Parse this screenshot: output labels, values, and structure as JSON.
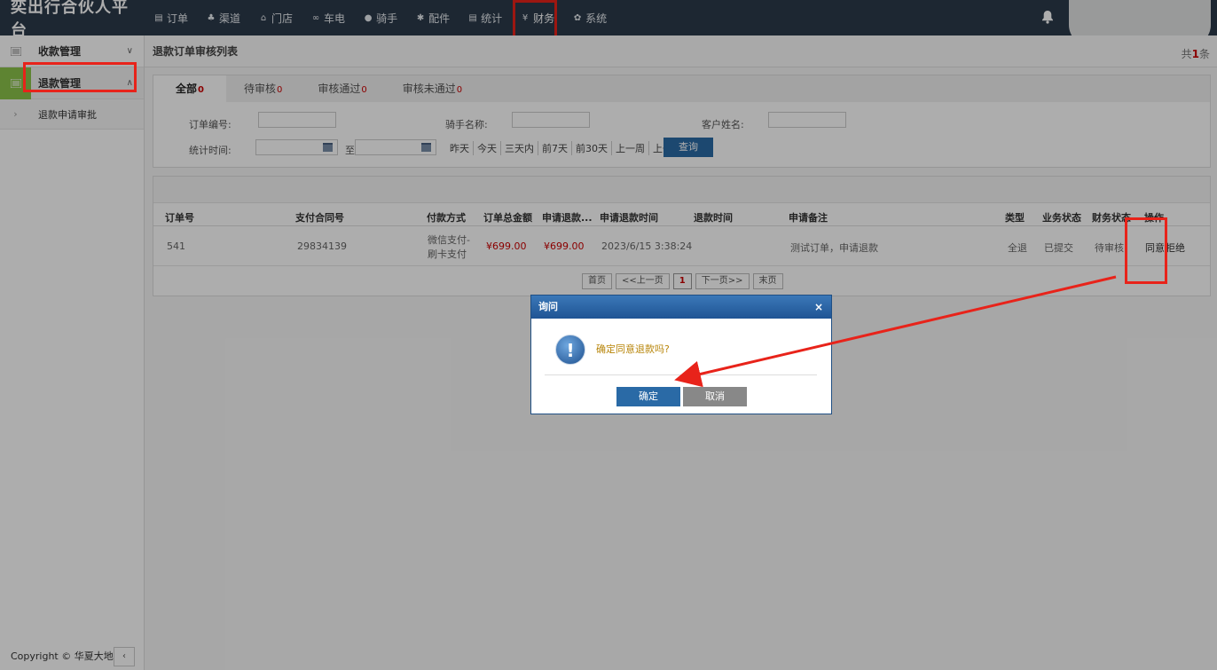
{
  "app": {
    "brand": "奕出行合伙人平台"
  },
  "nav": [
    {
      "label": "订单",
      "icon": "list-icon"
    },
    {
      "label": "渠道",
      "icon": "sitemap-icon"
    },
    {
      "label": "门店",
      "icon": "home-icon"
    },
    {
      "label": "车电",
      "icon": "bicycle-icon"
    },
    {
      "label": "骑手",
      "icon": "users-icon"
    },
    {
      "label": "配件",
      "icon": "gears-icon"
    },
    {
      "label": "统计",
      "icon": "chart-icon"
    },
    {
      "label": "财务",
      "icon": "yen-icon",
      "active": true
    },
    {
      "label": "系统",
      "icon": "gear-icon"
    }
  ],
  "sidebar": {
    "groups": [
      {
        "label": "收款管理",
        "expanded": false
      },
      {
        "label": "退款管理",
        "expanded": true
      }
    ],
    "sub_items": [
      {
        "label": "退款申请审批"
      }
    ],
    "copyright": "Copyright © 华夏大地",
    "collapse_label": "‹"
  },
  "main": {
    "breadcrumb": "退款订单审核列表",
    "total": {
      "prefix": "共",
      "count": "1",
      "suffix": "条"
    },
    "tabs": [
      {
        "label": "全部",
        "count": "0",
        "active": true
      },
      {
        "label": "待审核",
        "count": "0"
      },
      {
        "label": "审核通过",
        "count": "0"
      },
      {
        "label": "审核未通过",
        "count": "0"
      }
    ],
    "filters": {
      "order_no_label": "订单编号:",
      "rider_label": "骑手名称:",
      "customer_label": "客户姓名:",
      "time_label": "统计时间:",
      "to_label": "至",
      "quick": [
        "昨天",
        "今天",
        "三天内",
        "前7天",
        "前30天",
        "上一周",
        "上一月"
      ],
      "query_button": "查询"
    },
    "table": {
      "columns": [
        "订单号",
        "支付合同号",
        "付款方式",
        "订单总金额",
        "申请退款...",
        "申请退款时间",
        "退款时间",
        "申请备注",
        "类型",
        "业务状态",
        "财务状态",
        "操作"
      ],
      "rows": [
        {
          "order_no": "541",
          "contract_no": "29834139",
          "pay_method_1": "微信支付-",
          "pay_method_2": "刷卡支付",
          "total": "¥699.00",
          "refund_amount": "¥699.00",
          "apply_time": "2023/6/15 3:38:24",
          "refund_time": "",
          "remark": "测试订单，申请退款",
          "type": "全退",
          "biz_status": "已提交",
          "fin_status": "待审核",
          "op_agree": "同意",
          "op_reject": "拒绝"
        }
      ]
    },
    "pager": [
      "首页",
      "<<上一页",
      "1",
      "下一页>>",
      "末页"
    ]
  },
  "dialog": {
    "title": "询问",
    "close": "×",
    "message": "确定同意退款吗?",
    "ok": "确定",
    "cancel": "取消"
  },
  "colors": {
    "annotation": "#e8231a",
    "topbar": "#2c3a4b",
    "primary": "#2a6aa6",
    "active_group": "#8bc34a"
  }
}
